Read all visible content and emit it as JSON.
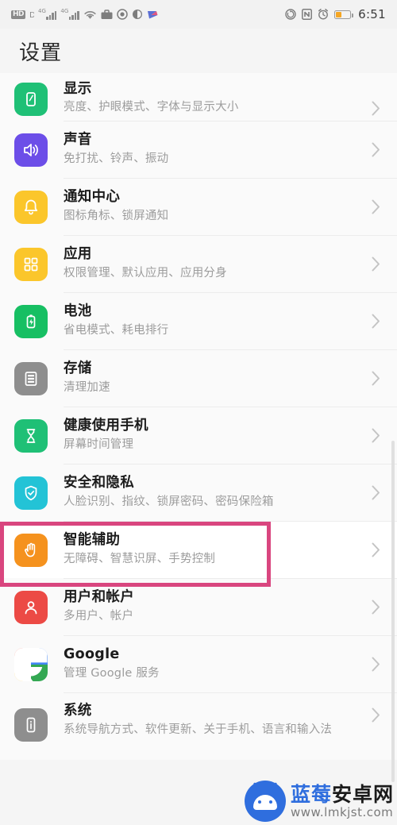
{
  "status_bar": {
    "hd_label": "HD",
    "network_generation": "4G",
    "time": "6:51",
    "left_icons": [
      "hd-volte-icon",
      "sim1-signal-icon",
      "sim2-signal-icon",
      "wifi-icon",
      "briefcase-work-icon",
      "do-not-disturb-icon",
      "headset-icon",
      "wechat-share-icon"
    ],
    "right_icons": [
      "auto-rotate-icon",
      "nfc-icon",
      "alarm-clock-icon",
      "battery-icon"
    ],
    "battery_level_pct": 40,
    "battery_color": "#f5a623"
  },
  "header": {
    "title": "设置"
  },
  "scrollbar": {
    "visible": true
  },
  "list": {
    "items": [
      {
        "title": "显示",
        "subtitle": "亮度、护眼模式、字体与显示大小",
        "icon": "display-icon",
        "color": "#1fc076",
        "clipped": true
      },
      {
        "title": "声音",
        "subtitle": "免打扰、铃声、振动",
        "icon": "sound-icon",
        "color": "#6c4ee8"
      },
      {
        "title": "通知中心",
        "subtitle": "图标角标、锁屏通知",
        "icon": "notification-bell-icon",
        "color": "#fbc62b"
      },
      {
        "title": "应用",
        "subtitle": "权限管理、默认应用、应用分身",
        "icon": "apps-grid-icon",
        "color": "#fbc62b"
      },
      {
        "title": "电池",
        "subtitle": "省电模式、耗电排行",
        "icon": "battery-icon",
        "color": "#17bf63"
      },
      {
        "title": "存储",
        "subtitle": "清理加速",
        "icon": "storage-icon",
        "color": "#8e8e8e"
      },
      {
        "title": "健康使用手机",
        "subtitle": "屏幕时间管理",
        "icon": "hourglass-icon",
        "color": "#1fc076"
      },
      {
        "title": "安全和隐私",
        "subtitle": "人脸识别、指纹、锁屏密码、密码保险箱",
        "icon": "shield-check-icon",
        "color": "#23c3d6"
      },
      {
        "title": "智能辅助",
        "subtitle": "无障碍、智慧识屏、手势控制",
        "icon": "hand-accessibility-icon",
        "color": "#f5921e",
        "highlighted": true
      },
      {
        "title": "用户和帐户",
        "subtitle": "多用户、帐户",
        "icon": "user-account-icon",
        "color": "#ec4a45"
      },
      {
        "title": "Google",
        "subtitle": "管理 Google 服务",
        "icon": "google-g-icon",
        "color": "#ffffff"
      },
      {
        "title": "系统",
        "subtitle": "系统导航方式、软件更新、关于手机、语言和输入法",
        "icon": "system-info-icon",
        "color": "#8e8e8e",
        "tall": true
      }
    ],
    "chevron_icon": "chevron-right-icon"
  },
  "highlight": {
    "color": "#d9467f"
  },
  "watermark": {
    "brand_blue": "蓝莓",
    "brand_dark": "安卓网",
    "url": "www.lmkjst.com",
    "logo": "android-robot-icon"
  }
}
